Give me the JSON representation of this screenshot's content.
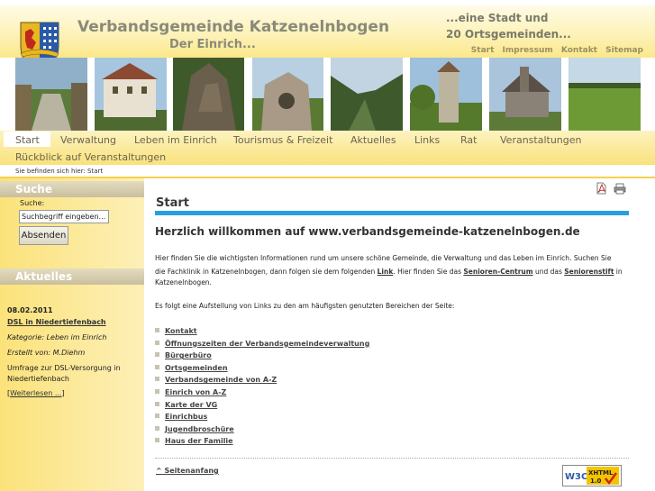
{
  "header": {
    "title": "Verbandsgemeinde Katzenelnbogen",
    "subtitle": "Der Einrich...",
    "tagline_1": "...eine Stadt und",
    "tagline_2": "20 Ortsgemeinden...",
    "toplinks": [
      "Start",
      "Impressum",
      "Kontakt",
      "Sitemap"
    ]
  },
  "nav": {
    "items": [
      "Start",
      "Verwaltung",
      "Leben im Einrich",
      "Tourismus & Freizeit",
      "Aktuelles",
      "Links",
      "Rat",
      "Veranstaltungen"
    ],
    "second_row": "Rückblick auf Veranstaltungen",
    "active": "Start"
  },
  "breadcrumb": "Sie befinden sich hier: Start",
  "sidebar": {
    "search_heading": "Suche",
    "search_label": "Suche:",
    "search_placeholder": "Suchbegriff eingeben...",
    "search_button": "Absenden",
    "news_heading": "Aktuelles",
    "news": {
      "date": "08.02.2011",
      "title": "DSL in Niedertiefenbach",
      "category": "Kategorie: Leben im Einrich",
      "author": "Erstellt von: M.Diehm",
      "text_1": "Umfrage zur DSL-Versorgung in",
      "text_2": "Niedertiefenbach",
      "more": "Weiterlesen ...",
      "more_open": "[",
      "more_close": "]"
    }
  },
  "main": {
    "title": "Start",
    "welcome": "Herzlich willkommen auf www.verbandsgemeinde-katzenelnbogen.de",
    "para1_line1": "Hier finden Sie die wichtigsten Informationen rund um unsere schöne Gemeinde, die Verwaltung und das Leben im Einrich. Suchen Sie",
    "para1_line2_a": "die Fachklinik in Katzenelnbogen, dann folgen sie dem folgenden ",
    "para1_link1": "Link",
    "para1_line2_b": ". Hier finden Sie das ",
    "para1_link2": "Senioren-Centrum",
    "para1_line2_c": " und das ",
    "para1_link3": "Seniorenstift",
    "para1_line2_d": " in",
    "para1_line3": "Katzenelnbogen.",
    "para2": "Es folgt eine Aufstellung von Links zu den am häufigsten genutzten Bereichen der Seite:",
    "links": [
      "Kontakt",
      "Öffnungszeiten der Verbandsgemeindeverwaltung",
      "Bürgerbüro",
      "Ortsgemeinden",
      "Verbandsgemeinde von A-Z",
      "Einrich von A-Z",
      "Karte der VG",
      "Einrichbus",
      "Jugendbroschüre",
      "Haus der Familie"
    ],
    "top_link": "^ Seitenanfang",
    "badge_w3c": "W3C",
    "badge_xhtml": "XHTML",
    "badge_version": "1.0"
  },
  "colors": {
    "accent_blue": "#2a9de0",
    "nav_yellow": "#f9e27c",
    "sidebar_yellow": "#fbe27a"
  },
  "icons": [
    "crest-logo",
    "pdf-icon",
    "print-icon",
    "w3c-xhtml-badge"
  ]
}
